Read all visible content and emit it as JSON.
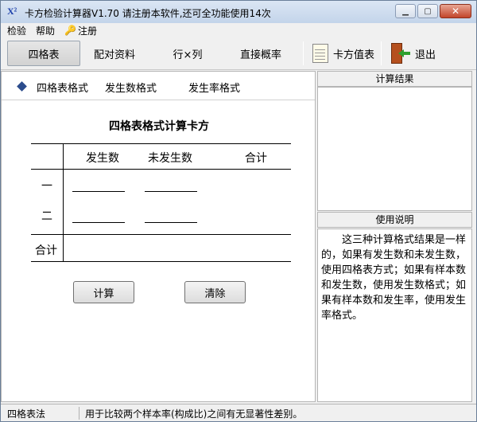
{
  "window": {
    "title": "卡方检验计算器V1.70    请注册本软件,还可全功能使用14次",
    "icon_label": "X²"
  },
  "menu": {
    "items": [
      "检验",
      "帮助",
      "注册"
    ]
  },
  "toolbar": {
    "buttons": [
      "四格表",
      "配对资料",
      "行×列",
      "直接概率",
      "卡方值表",
      "退出"
    ]
  },
  "format_tabs": [
    "四格表格式",
    "发生数格式",
    "发生率格式"
  ],
  "calc": {
    "title": "四格表格式计算卡方",
    "col_headers": [
      "发生数",
      "未发生数",
      "合计"
    ],
    "row_labels": [
      "一",
      "二",
      "合计"
    ],
    "inputs": [
      [
        "",
        ""
      ],
      [
        "",
        ""
      ]
    ],
    "calc_button": "计算",
    "clear_button": "清除"
  },
  "right": {
    "result_header": "计算结果",
    "result_text": "",
    "help_header": "使用说明",
    "help_text": "这三种计算格式结果是一样的，如果有发生数和未发生数，使用四格表方式；如果有样本数和发生数，使用发生数格式；如果有样本数和发生率，使用发生率格式。"
  },
  "status": {
    "mode": "四格表法",
    "description": "用于比较两个样本率(构成比)之间有无显著性差别。"
  },
  "colors": {
    "accent": "#2b4c8c",
    "title_gradient_top": "#dbe6f4",
    "close_button": "#c2452a"
  }
}
